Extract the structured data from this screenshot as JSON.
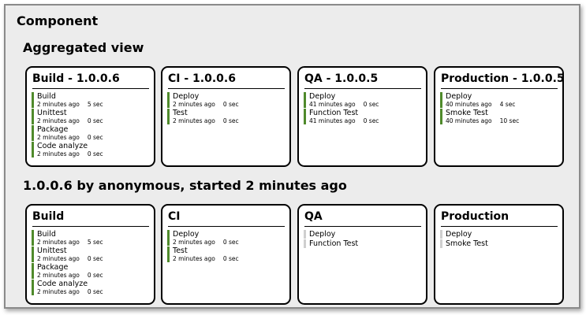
{
  "page_title": "Component",
  "aggregated_title": "Aggregated view",
  "run_title": "1.0.0.6 by anonymous, started 2 minutes ago",
  "aggregated": [
    {
      "title": "Build - 1.0.0.6",
      "steps": [
        {
          "name": "Build",
          "time": "2 minutes ago",
          "duration": "5 sec",
          "status": "success"
        },
        {
          "name": "Unittest",
          "time": "2 minutes ago",
          "duration": "0 sec",
          "status": "success"
        },
        {
          "name": "Package",
          "time": "2 minutes ago",
          "duration": "0 sec",
          "status": "success"
        },
        {
          "name": "Code analyze",
          "time": "2 minutes ago",
          "duration": "0 sec",
          "status": "success"
        }
      ]
    },
    {
      "title": "CI - 1.0.0.6",
      "steps": [
        {
          "name": "Deploy",
          "time": "2 minutes ago",
          "duration": "0 sec",
          "status": "success"
        },
        {
          "name": "Test",
          "time": "2 minutes ago",
          "duration": "0 sec",
          "status": "success"
        }
      ]
    },
    {
      "title": "QA - 1.0.0.5",
      "steps": [
        {
          "name": "Deploy",
          "time": "41 minutes ago",
          "duration": "0 sec",
          "status": "success"
        },
        {
          "name": "Function Test",
          "time": "41 minutes ago",
          "duration": "0 sec",
          "status": "success"
        }
      ]
    },
    {
      "title": "Production - 1.0.0.5",
      "steps": [
        {
          "name": "Deploy",
          "time": "40 minutes ago",
          "duration": "4 sec",
          "status": "success"
        },
        {
          "name": "Smoke Test",
          "time": "40 minutes ago",
          "duration": "10 sec",
          "status": "success"
        }
      ]
    }
  ],
  "run": [
    {
      "title": "Build",
      "steps": [
        {
          "name": "Build",
          "time": "2 minutes ago",
          "duration": "5 sec",
          "status": "success"
        },
        {
          "name": "Unittest",
          "time": "2 minutes ago",
          "duration": "0 sec",
          "status": "success"
        },
        {
          "name": "Package",
          "time": "2 minutes ago",
          "duration": "0 sec",
          "status": "success"
        },
        {
          "name": "Code analyze",
          "time": "2 minutes ago",
          "duration": "0 sec",
          "status": "success"
        }
      ]
    },
    {
      "title": "CI",
      "steps": [
        {
          "name": "Deploy",
          "time": "2 minutes ago",
          "duration": "0 sec",
          "status": "success"
        },
        {
          "name": "Test",
          "time": "2 minutes ago",
          "duration": "0 sec",
          "status": "success"
        }
      ]
    },
    {
      "title": "QA",
      "steps": [
        {
          "name": "Deploy",
          "time": "",
          "duration": "",
          "status": "pending"
        },
        {
          "name": "Function Test",
          "time": "",
          "duration": "",
          "status": "pending"
        }
      ]
    },
    {
      "title": "Production",
      "steps": [
        {
          "name": "Deploy",
          "time": "",
          "duration": "",
          "status": "pending"
        },
        {
          "name": "Smoke Test",
          "time": "",
          "duration": "",
          "status": "pending"
        }
      ]
    }
  ],
  "colors": {
    "success": "#4f8a2b",
    "pending": "#cfcfcf"
  }
}
